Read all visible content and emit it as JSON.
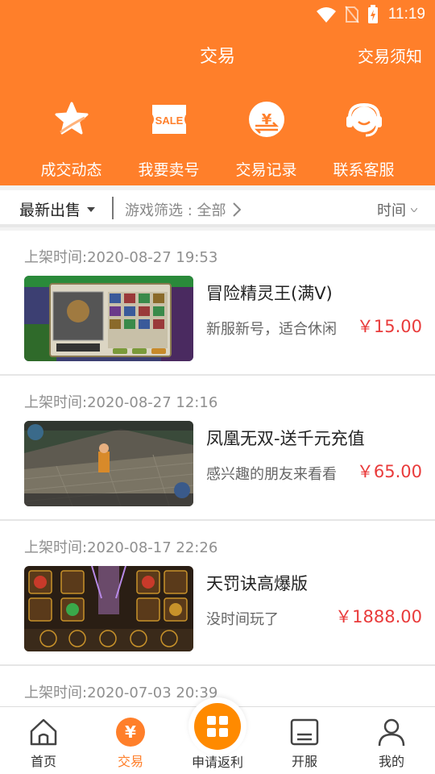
{
  "status": {
    "time": "11:19"
  },
  "header": {
    "title": "交易",
    "notice_link": "交易须知"
  },
  "quick_actions": [
    {
      "label": "成交动态",
      "icon": "star-icon"
    },
    {
      "label": "我要卖号",
      "icon": "sale-tag-icon"
    },
    {
      "label": "交易记录",
      "icon": "yuan-exchange-icon"
    },
    {
      "label": "联系客服",
      "icon": "headset-icon"
    }
  ],
  "filter": {
    "sort_label": "最新出售",
    "game_filter": "游戏筛选 : 全部",
    "time_label": "时间"
  },
  "listings": [
    {
      "time": "上架时间:2020-08-27 19:53",
      "name": "冒险精灵王(满V)",
      "desc": "新服新号，适合休闲",
      "price": "￥15.00"
    },
    {
      "time": "上架时间:2020-08-27 12:16",
      "name": "凤凰无双-送千元充值",
      "desc": "感兴趣的朋友来看看",
      "price": "￥65.00"
    },
    {
      "time": "上架时间:2020-08-17 22:26",
      "name": "天罚诀高爆版",
      "desc": "没时间玩了",
      "price": "￥1888.00"
    },
    {
      "time": "上架时间:2020-07-03 20:39",
      "name": "",
      "desc": "",
      "price": ""
    }
  ],
  "tabbar": {
    "home": "首页",
    "trade": "交易",
    "rebate": "申请返利",
    "server": "开服",
    "mine": "我的"
  },
  "colors": {
    "brand": "#ff7f2a",
    "price": "#e93b3b"
  }
}
